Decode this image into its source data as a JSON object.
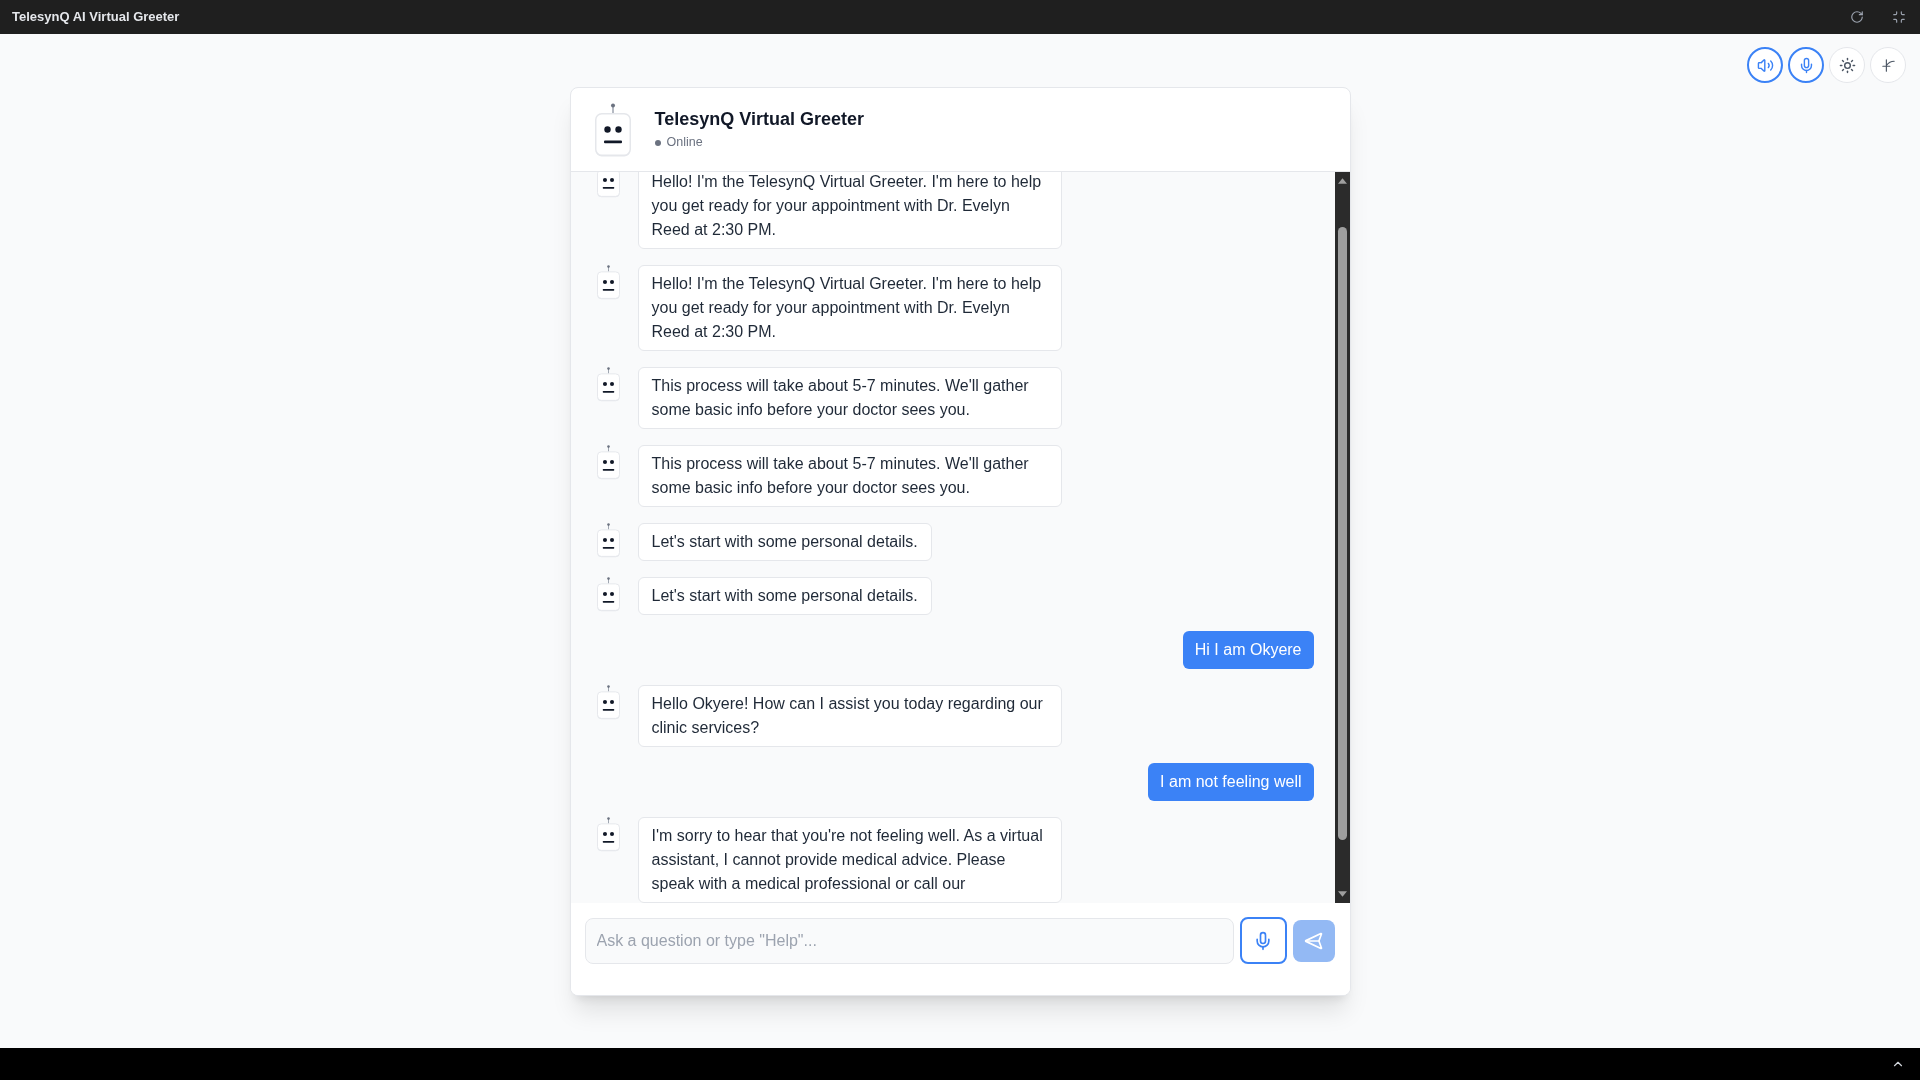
{
  "app_bar": {
    "title": "TelesynQ AI Virtual Greeter"
  },
  "toolbar": [
    {
      "kind": "speaker",
      "on": true
    },
    {
      "kind": "microphone",
      "on": true
    },
    {
      "kind": "theme",
      "on": false
    },
    {
      "kind": "curve",
      "on": false
    }
  ],
  "chat": {
    "title": "TelesynQ Virtual Greeter",
    "status": "Online",
    "messages": [
      {
        "kind": "bot",
        "text": "Hello! I'm the TelesynQ Virtual Greeter. I'm here to help you get ready for your appointment with Dr. Evelyn Reed at 2:30 PM."
      },
      {
        "kind": "bot",
        "text": "Hello! I'm the TelesynQ Virtual Greeter. I'm here to help you get ready for your appointment with Dr. Evelyn Reed at 2:30 PM."
      },
      {
        "kind": "bot",
        "text": "This process will take about 5-7 minutes. We'll gather some basic info before your doctor sees you."
      },
      {
        "kind": "bot",
        "text": "This process will take about 5-7 minutes. We'll gather some basic info before your doctor sees you."
      },
      {
        "kind": "bot",
        "text": "Let's start with some personal details."
      },
      {
        "kind": "bot",
        "text": "Let's start with some personal details."
      },
      {
        "kind": "user",
        "text": "Hi I am Okyere"
      },
      {
        "kind": "bot",
        "text": "Hello Okyere! How can I assist you today regarding our clinic services?"
      },
      {
        "kind": "user",
        "text": "I am not feeling well"
      },
      {
        "kind": "bot",
        "text": "I'm sorry to hear that you're not feeling well. As a virtual assistant, I cannot provide medical advice. Please speak with a medical professional or call our"
      }
    ],
    "composer": {
      "placeholder": "Ask a question or type \"Help\"...",
      "mic_on": true,
      "send_disabled": true
    }
  }
}
